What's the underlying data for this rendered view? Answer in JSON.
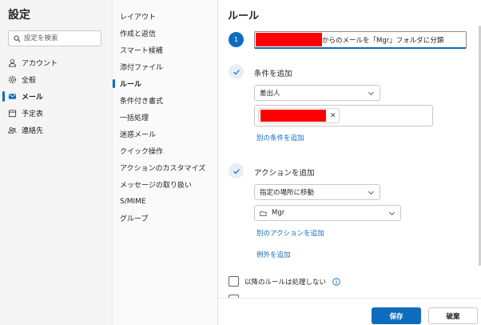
{
  "settings": {
    "title": "設定",
    "search_placeholder": "設定を検索"
  },
  "nav": [
    {
      "label": "アカウント",
      "icon": "person-icon"
    },
    {
      "label": "全般",
      "icon": "gear-icon"
    },
    {
      "label": "メール",
      "icon": "mail-icon",
      "active": true
    },
    {
      "label": "予定表",
      "icon": "calendar-icon"
    },
    {
      "label": "連絡先",
      "icon": "people-icon"
    }
  ],
  "mail_menu": [
    "レイアウト",
    "作成と返信",
    "スマート候補",
    "添付ファイル",
    "ルール",
    "条件付き書式",
    "一括処理",
    "迷惑メール",
    "クイック操作",
    "アクションのカスタマイズ",
    "メッセージの取り扱い",
    "S/MIME",
    "グループ"
  ],
  "mail_menu_active": "ルール",
  "rule": {
    "title": "ルール",
    "step_number": "1",
    "name_suffix": "からのメールを「Mgr」フォルダに分類",
    "condition": {
      "heading": "条件を追加",
      "type": "差出人",
      "add_link": "別の条件を追加"
    },
    "action": {
      "heading": "アクションを追加",
      "type": "指定の場所に移動",
      "folder": "Mgr",
      "add_link": "別のアクションを追加"
    },
    "exception_link": "例外を追加",
    "stop_processing_label": "以降のルールは処理しない"
  },
  "buttons": {
    "save": "保存",
    "discard": "破棄"
  },
  "colors": {
    "accent": "#0f6cbd",
    "redaction": "#ff0000"
  }
}
